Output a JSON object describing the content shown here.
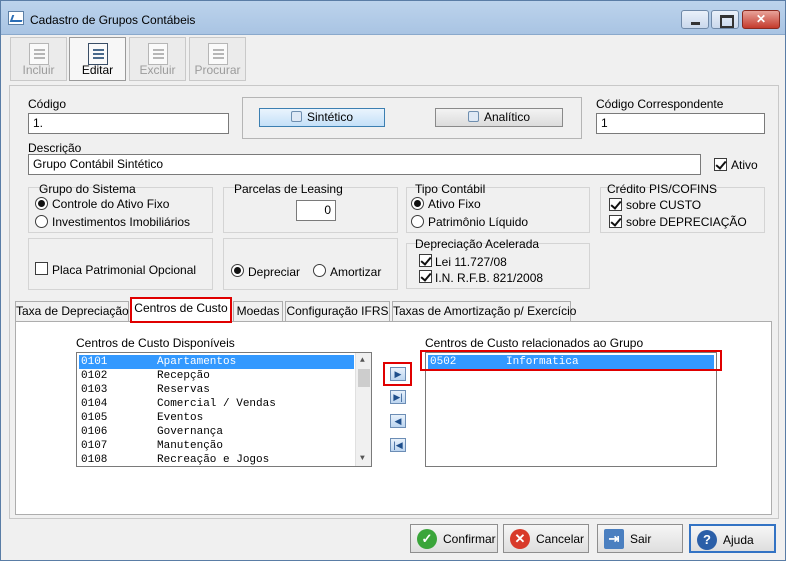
{
  "window": {
    "title": "Cadastro de Grupos Contábeis"
  },
  "toolbar": {
    "buttons": [
      {
        "label": "Incluir",
        "enabled": false
      },
      {
        "label": "Editar",
        "enabled": true
      },
      {
        "label": "Excluir",
        "enabled": false
      },
      {
        "label": "Procurar",
        "enabled": false
      }
    ]
  },
  "form": {
    "codigo_label": "Código",
    "codigo_value": "1.",
    "sintetico_label": "Sintético",
    "analitico_label": "Analítico",
    "codigo_corr_label": "Código Correspondente",
    "codigo_corr_value": "1",
    "descricao_label": "Descrição",
    "descricao_value": "Grupo Contábil Sintético",
    "ativo_label": "Ativo",
    "ativo_checked": true
  },
  "grupo_sistema": {
    "title": "Grupo do Sistema",
    "options": [
      "Controle do Ativo Fixo",
      "Investimentos Imobiliários"
    ],
    "selected": "Controle do Ativo Fixo"
  },
  "parcelas": {
    "title": "Parcelas de Leasing",
    "value": "0"
  },
  "tipo_contabil": {
    "title": "Tipo Contábil",
    "options": [
      "Ativo Fixo",
      "Patrimônio Líquido"
    ],
    "selected": "Ativo Fixo"
  },
  "credito": {
    "title": "Crédito PIS/COFINS",
    "options": [
      "sobre CUSTO",
      "sobre DEPRECIAÇÃO"
    ],
    "checked": [
      true,
      true
    ]
  },
  "placa": {
    "label": "Placa Patrimonial Opcional",
    "checked": false
  },
  "depreciar": {
    "options": [
      "Depreciar",
      "Amortizar"
    ],
    "selected": "Depreciar"
  },
  "depreciacao_acelerada": {
    "title": "Depreciação Acelerada",
    "options": [
      "Lei 11.727/08",
      "I.N. R.F.B. 821/2008"
    ],
    "checked": [
      true,
      true
    ]
  },
  "tabs": [
    {
      "label": "Taxa de Depreciação",
      "active": false
    },
    {
      "label": "Centros de Custo",
      "active": true
    },
    {
      "label": "Moedas",
      "active": false
    },
    {
      "label": "Configuração IFRS",
      "active": false
    },
    {
      "label": "Taxas de Amortização p/ Exercício",
      "active": false
    }
  ],
  "centros": {
    "disponiveis_label": "Centros de Custo Disponíveis",
    "disponiveis": [
      {
        "code": "0101",
        "name": "Apartamentos",
        "selected": true
      },
      {
        "code": "0102",
        "name": "Recepção",
        "selected": false
      },
      {
        "code": "0103",
        "name": "Reservas",
        "selected": false
      },
      {
        "code": "0104",
        "name": "Comercial / Vendas",
        "selected": false
      },
      {
        "code": "0105",
        "name": "Eventos",
        "selected": false
      },
      {
        "code": "0106",
        "name": "Governança",
        "selected": false
      },
      {
        "code": "0107",
        "name": "Manutenção",
        "selected": false
      },
      {
        "code": "0108",
        "name": "Recreação e Jogos",
        "selected": false
      }
    ],
    "relacionados_label": "Centros de Custo relacionados ao Grupo",
    "relacionados": [
      {
        "code": "0502",
        "name": "Informatica",
        "selected": true
      }
    ]
  },
  "footer": {
    "confirmar": "Confirmar",
    "cancelar": "Cancelar",
    "sair": "Sair",
    "ajuda": "Ajuda"
  },
  "colors": {
    "selection": "#3399ff",
    "highlight_box": "#e00000"
  }
}
